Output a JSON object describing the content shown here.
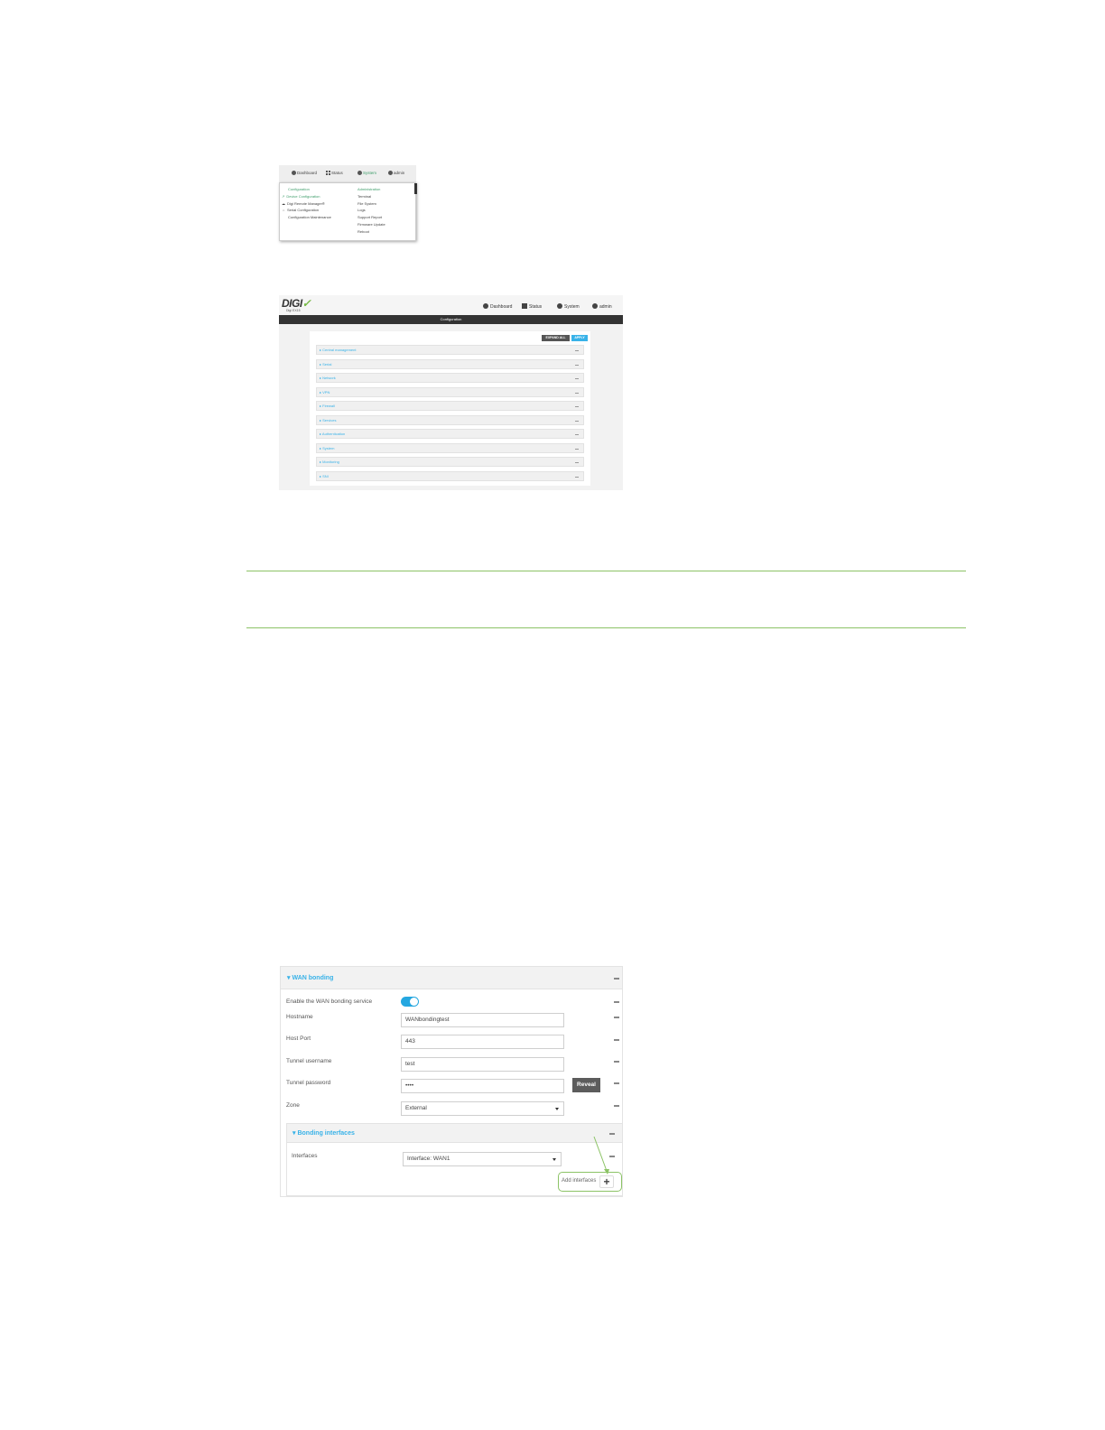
{
  "menu_shot": {
    "nav": {
      "dashboard": "Dashboard",
      "status": "Status",
      "system": "System",
      "user": "admin"
    },
    "config_col": {
      "heading": "Configuration",
      "items": [
        "Device Configuration",
        "Digi Remote Manager®",
        "Serial Configuration",
        "Configuration Maintenance"
      ]
    },
    "admin_col": {
      "heading": "Administration",
      "items": [
        "Terminal",
        "File System",
        "Logs",
        "Support Report",
        "Firmware Update",
        "Reboot"
      ]
    }
  },
  "config_shot": {
    "logo": "DIGI",
    "model": "Digi EX15",
    "nav": {
      "dashboard": "Dashboard",
      "status": "Status",
      "system": "System",
      "user": "admin"
    },
    "bar_title": "Configuration",
    "expand_all": "EXPAND ALL",
    "apply": "APPLY",
    "sections": [
      "Central management",
      "Serial",
      "Network",
      "VPN",
      "Firewall",
      "Services",
      "Authentication",
      "System",
      "Monitoring",
      "SNI"
    ]
  },
  "wan_shot": {
    "title": "WAN bonding",
    "enable_label": "Enable the WAN bonding service",
    "hostname_label": "Hostname",
    "hostname_value": "WANbondingtest",
    "port_label": "Host Port",
    "port_value": "443",
    "username_label": "Tunnel username",
    "username_value": "test",
    "password_label": "Tunnel password",
    "password_value": "••••",
    "reveal": "Reveal",
    "zone_label": "Zone",
    "zone_value": "External",
    "bonding_title": "Bonding interfaces",
    "interfaces_label": "Interfaces",
    "interfaces_value": "Interface: WAN1",
    "add_label": "Add interfaces",
    "plus": "+"
  },
  "colors": {
    "accent_blue": "#38b2e8",
    "toggle_blue": "#25a7e0",
    "digi_green": "#75b843",
    "rule_green": "#8cc366",
    "menu_green": "#3e9d6a"
  }
}
